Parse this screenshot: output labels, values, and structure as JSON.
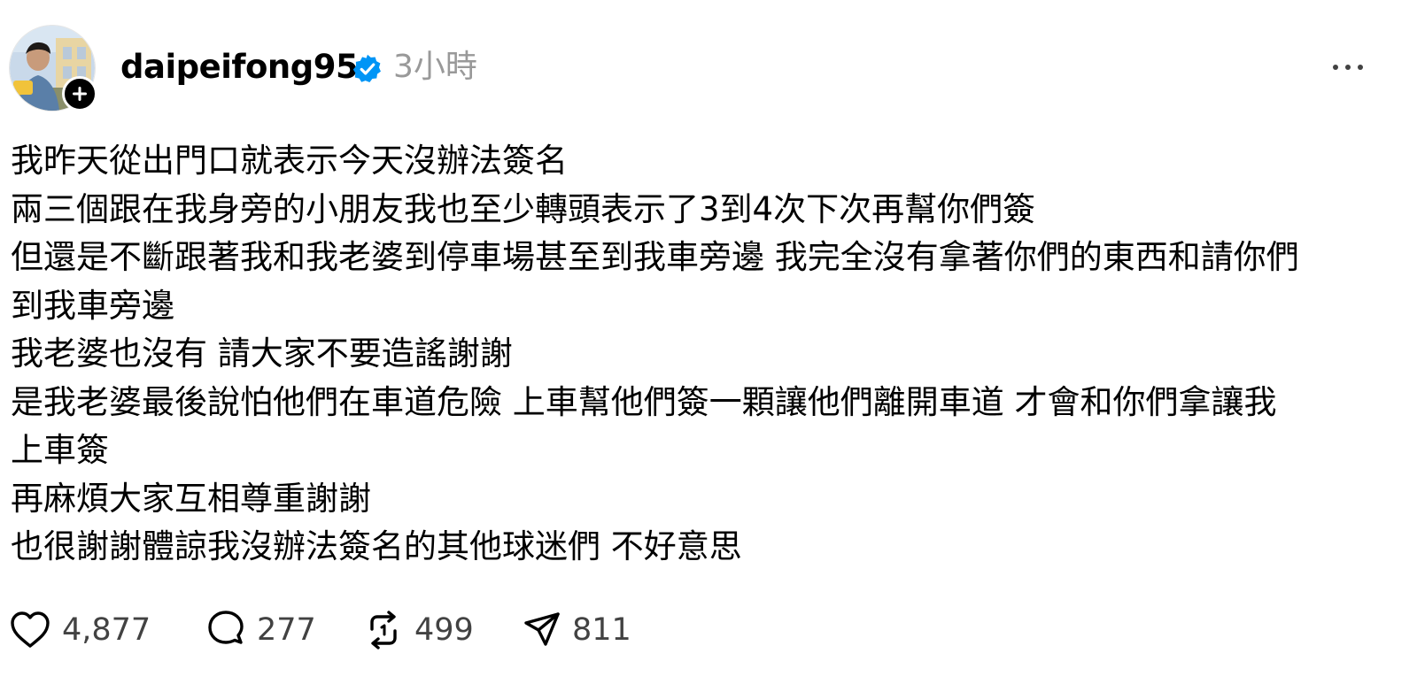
{
  "post": {
    "author": {
      "username": "daipeifong95",
      "verified": true,
      "avatar_icon": "profile-photo",
      "follow_icon": "plus-icon"
    },
    "timestamp": "3小時",
    "more_icon": "more-horizontal-icon",
    "lines": [
      "我昨天從出門口就表示今天沒辦法簽名",
      "兩三個跟在我身旁的小朋友我也至少轉頭表示了3到4次下次再幫你們簽",
      "但還是不斷跟著我和我老婆到停車場甚至到我車旁邊 我完全沒有拿著你們的東西和請你們",
      "到我車旁邊",
      "我老婆也沒有 請大家不要造謠謝謝",
      "是我老婆最後說怕他們在車道危險 上車幫他們簽一顆讓他們離開車道 才會和你們拿讓我",
      "上車簽",
      "再麻煩大家互相尊重謝謝",
      "也很謝謝體諒我沒辦法簽名的其他球迷們 不好意思"
    ],
    "actions": {
      "likes": "4,877",
      "comments": "277",
      "reposts": "499",
      "shares": "811"
    }
  },
  "colors": {
    "text": "#000000",
    "muted": "#999999",
    "count": "#424242",
    "verified_badge": "#0095f6"
  }
}
